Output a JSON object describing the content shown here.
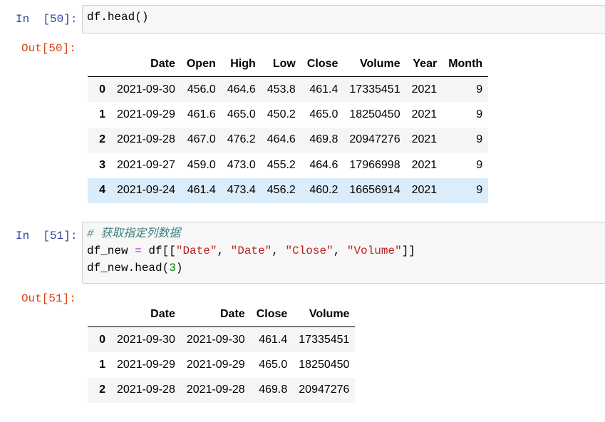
{
  "cell50": {
    "in_prompt": "In  [50]:",
    "code": {
      "obj": "df",
      "dot": ".",
      "method": "head",
      "call": "()"
    },
    "out_prompt": "Out[50]:",
    "table": {
      "columns": [
        "",
        "Date",
        "Open",
        "High",
        "Low",
        "Close",
        "Volume",
        "Year",
        "Month"
      ],
      "rows": [
        {
          "index": "0",
          "cells": [
            "2021-09-30",
            "456.0",
            "464.6",
            "453.8",
            "461.4",
            "17335451",
            "2021",
            "9"
          ]
        },
        {
          "index": "1",
          "cells": [
            "2021-09-29",
            "461.6",
            "465.0",
            "450.2",
            "465.0",
            "18250450",
            "2021",
            "9"
          ]
        },
        {
          "index": "2",
          "cells": [
            "2021-09-28",
            "467.0",
            "476.2",
            "464.6",
            "469.8",
            "20947276",
            "2021",
            "9"
          ]
        },
        {
          "index": "3",
          "cells": [
            "2021-09-27",
            "459.0",
            "473.0",
            "455.2",
            "464.6",
            "17966998",
            "2021",
            "9"
          ]
        },
        {
          "index": "4",
          "cells": [
            "2021-09-24",
            "461.4",
            "473.4",
            "456.2",
            "460.2",
            "16656914",
            "2021",
            "9"
          ]
        }
      ]
    }
  },
  "cell51": {
    "in_prompt": "In  [51]:",
    "code": {
      "comment": "# 获取指定列数据",
      "l2_a": "df_new ",
      "l2_eq": "=",
      "l2_b": " df[[",
      "l2_s1": "\"Date\"",
      "l2_c1": ", ",
      "l2_s2": "\"Date\"",
      "l2_c2": ", ",
      "l2_s3": "\"Close\"",
      "l2_c3": ", ",
      "l2_s4": "\"Volume\"",
      "l2_end": "]]",
      "l3_a": "df_new.head(",
      "l3_num": "3",
      "l3_end": ")"
    },
    "out_prompt": "Out[51]:",
    "table": {
      "columns": [
        "",
        "Date",
        "Date",
        "Close",
        "Volume"
      ],
      "rows": [
        {
          "index": "0",
          "cells": [
            "2021-09-30",
            "2021-09-30",
            "461.4",
            "17335451"
          ]
        },
        {
          "index": "1",
          "cells": [
            "2021-09-29",
            "2021-09-29",
            "465.0",
            "18250450"
          ]
        },
        {
          "index": "2",
          "cells": [
            "2021-09-28",
            "2021-09-28",
            "469.8",
            "20947276"
          ]
        }
      ]
    }
  },
  "colors": {
    "in_prompt": "#303f9f",
    "out_prompt": "#d84315",
    "comment": "#408080",
    "string": "#ba2121",
    "number": "#008000",
    "operator": "#aa22ff",
    "row_stripe": "#f5f5f5",
    "row_hover": "#dbecfa"
  }
}
